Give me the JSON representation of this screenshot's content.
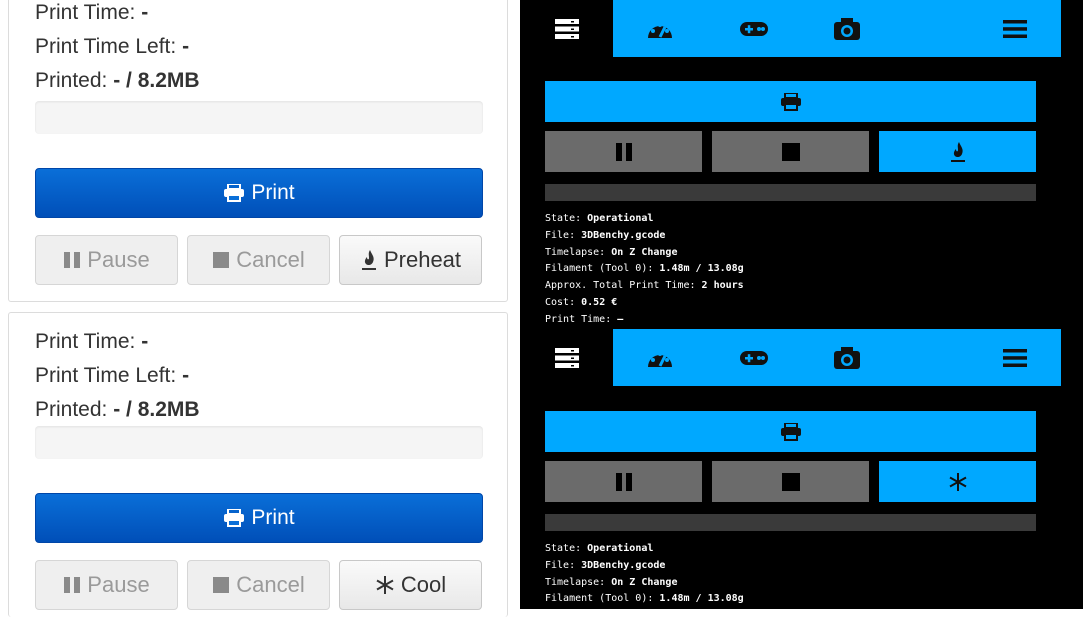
{
  "left": {
    "top": {
      "print_time_label": "Print Time:",
      "print_time_value": "-",
      "print_time_left_label": "Print Time Left:",
      "print_time_left_value": "-",
      "printed_label": "Printed:",
      "printed_value": "- / 8.2MB",
      "print_button": "Print",
      "pause_button": "Pause",
      "cancel_button": "Cancel",
      "third_button": "Preheat"
    },
    "bottom": {
      "print_time_label": "Print Time:",
      "print_time_value": "-",
      "print_time_left_label": "Print Time Left:",
      "print_time_left_value": "-",
      "printed_label": "Printed:",
      "printed_value": "- / 8.2MB",
      "print_button": "Print",
      "pause_button": "Pause",
      "cancel_button": "Cancel",
      "third_button": "Cool"
    }
  },
  "mobile": {
    "top": {
      "tabs": [
        "files-icon",
        "dashboard-icon",
        "gamepad-icon",
        "camera-icon",
        "menu-icon"
      ],
      "third_icon": "flame-icon",
      "state_label": "State:",
      "state_value": "Operational",
      "file_label": "File:",
      "file_value": "3DBenchy.gcode",
      "timelapse_label": "Timelapse:",
      "timelapse_value": "On Z Change",
      "filament_label": "Filament (Tool 0):",
      "filament_value": "1.48m / 13.08g",
      "approx_label": "Approx. Total Print Time:",
      "approx_value": "2 hours",
      "cost_label": "Cost:",
      "cost_value": "0.52 €",
      "print_time_label": "Print Time:",
      "print_time_value": "–"
    },
    "bottom": {
      "tabs": [
        "files-icon",
        "dashboard-icon",
        "gamepad-icon",
        "camera-icon",
        "menu-icon"
      ],
      "third_icon": "snowflake-icon",
      "state_label": "State:",
      "state_value": "Operational",
      "file_label": "File:",
      "file_value": "3DBenchy.gcode",
      "timelapse_label": "Timelapse:",
      "timelapse_value": "On Z Change",
      "filament_label": "Filament (Tool 0):",
      "filament_value": "1.48m / 13.08g"
    }
  },
  "colors": {
    "accent": "#00a8ff",
    "print_button": "#0a6fd8",
    "mobile_bg": "#000000"
  }
}
